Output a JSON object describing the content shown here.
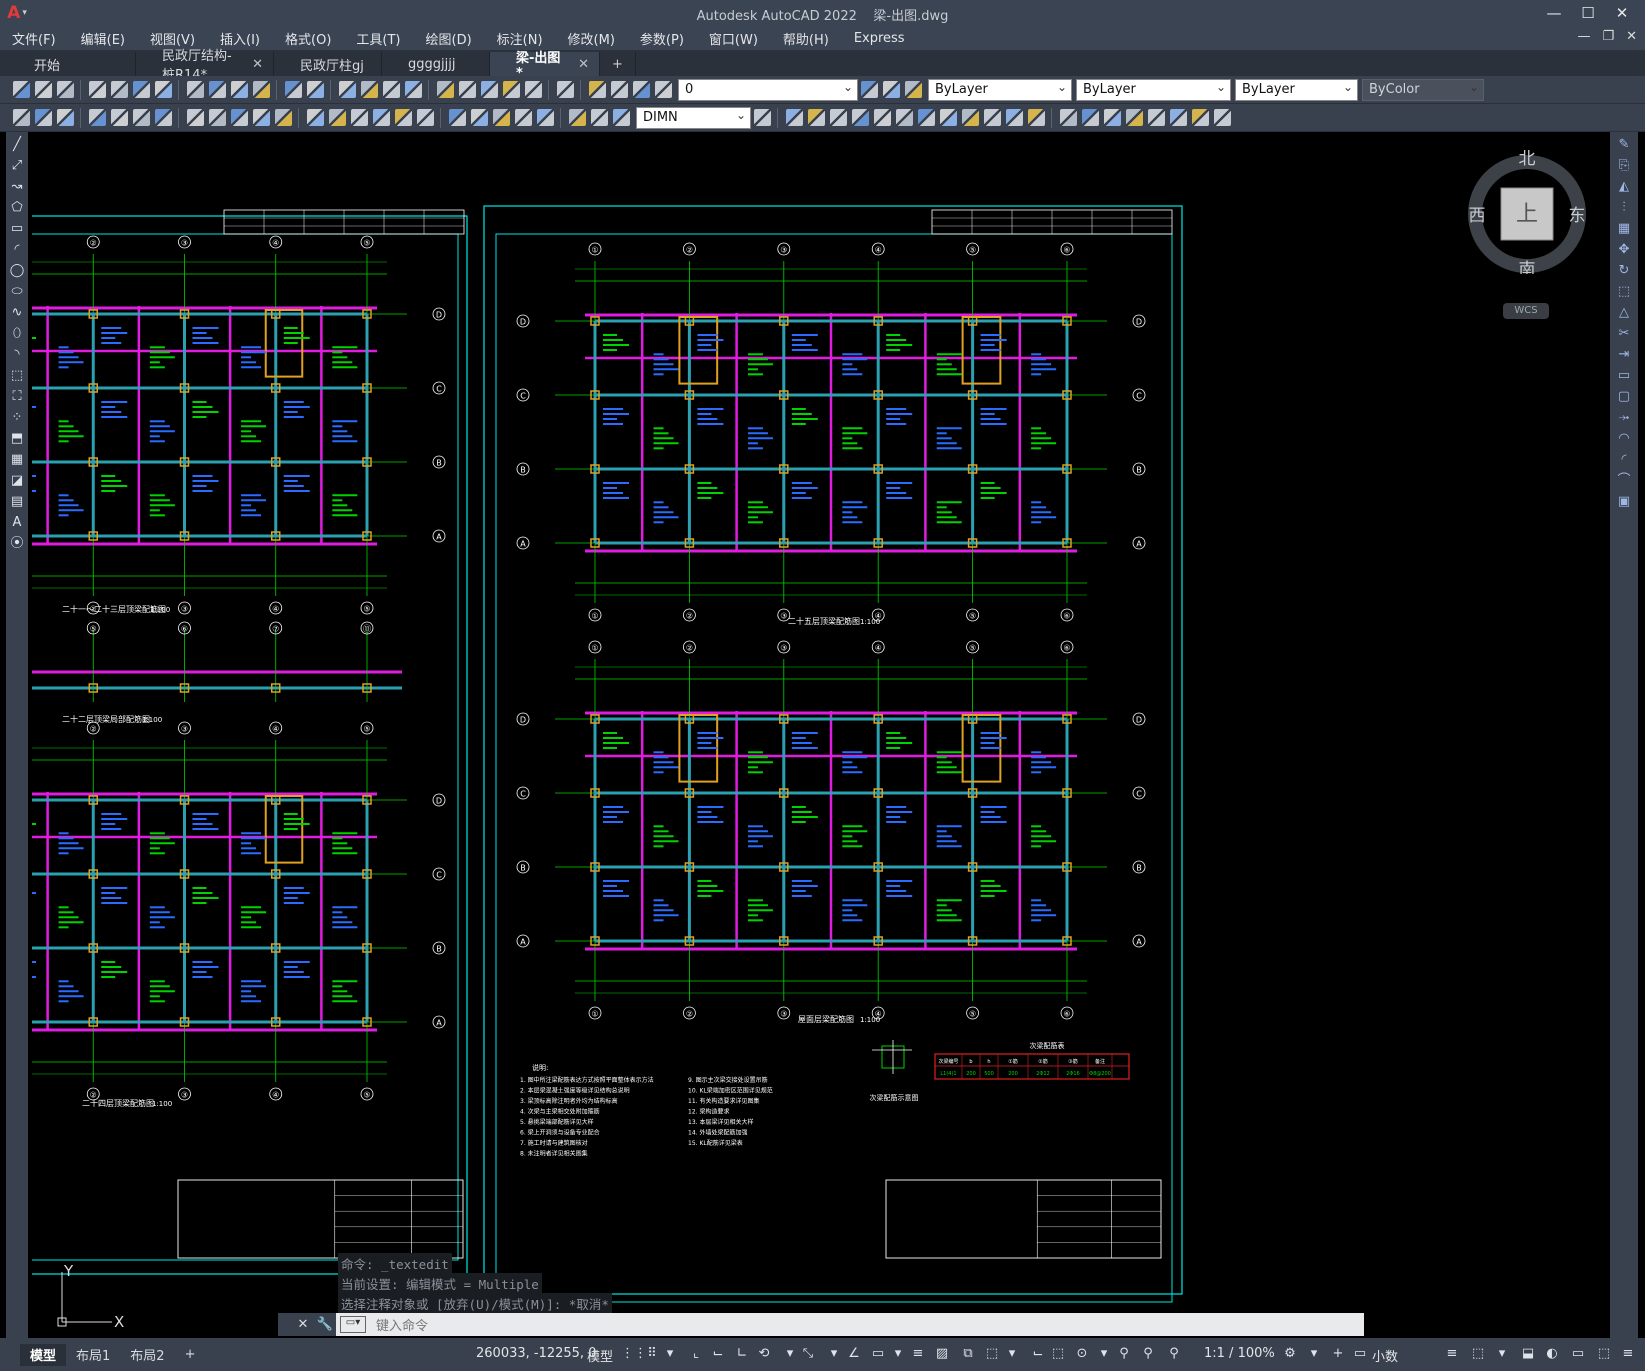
{
  "window": {
    "app_title": "Autodesk AutoCAD 2022",
    "file_title": "梁-出图.dwg",
    "logo_text": "A"
  },
  "menu": [
    "文件(F)",
    "编辑(E)",
    "视图(V)",
    "插入(I)",
    "格式(O)",
    "工具(T)",
    "绘图(D)",
    "标注(N)",
    "修改(M)",
    "参数(P)",
    "窗口(W)",
    "帮助(H)",
    "Express"
  ],
  "tabs": [
    {
      "label": "开始",
      "closable": false,
      "active": false
    },
    {
      "label": "民政厅结构-桩R14*",
      "closable": true,
      "active": false
    },
    {
      "label": "民政厅柱gj",
      "closable": false,
      "active": false
    },
    {
      "label": "ggggjjjj",
      "closable": false,
      "active": false
    },
    {
      "label": "梁-出图*",
      "closable": true,
      "active": true
    }
  ],
  "tab_plus": "+",
  "toolbar": {
    "layer_value": "0",
    "color_value": "ByLayer",
    "linetype_value": "ByLayer",
    "lineweight_value": "ByLayer",
    "plotstyle_value": "ByColor",
    "dimstyle_value": "DIMN"
  },
  "viewcube": {
    "north": "北",
    "south": "南",
    "east": "东",
    "west": "西",
    "face": "上",
    "wcs": "WCS"
  },
  "drawing": {
    "left_plan_titles": [
      "二十一～二十三层顶梁配筋图",
      "二十二层顶梁局部配筋图",
      "二十四层顶梁配筋图"
    ],
    "right_plan_titles": [
      "二十五层顶梁配筋图",
      "屋面层梁配筋图"
    ],
    "scale_note": "1:100",
    "notes_heading": "说明:",
    "notes": [
      "1. 图中所注梁配筋表达方式按照平面整体表示方法",
      "2. 本层梁混凝土强度等级详见结构总说明",
      "3. 梁顶标高除注明者外均为结构标高",
      "4. 次梁与主梁相交处附加箍筋",
      "5. 悬挑梁端部配筋详见大样",
      "6. 梁上开洞须与设备专业配合",
      "7. 施工时请与建筑图核对",
      "8. 未注明者详见相关图集"
    ],
    "notes_right": [
      "9. 图示主次梁交接处设置吊筋",
      "10. KL梁端加密区范围详见规范",
      "11. 有关构造要求详见图集",
      "12. 梁构造要求",
      "13. 本层梁详见相关大样",
      "14. 外墙处梁配筋加强",
      "15. KL配筋详见梁表"
    ],
    "beam_table_title": "次梁配筋表",
    "beam_table_headers": [
      "次梁编号",
      "b",
      "h",
      "①筋",
      "②筋",
      "③筋",
      "备注"
    ],
    "beam_table_row": [
      "L1(4)1",
      "200",
      "500",
      "200",
      "2Φ12",
      "2Φ16",
      "Φ8@200"
    ],
    "detail_caption": "次梁配筋示意图",
    "axis_numbers": [
      "①",
      "②",
      "③",
      "④",
      "⑤",
      "⑥",
      "⑦",
      "⑪"
    ],
    "axis_letters": [
      "A",
      "B",
      "C",
      "D"
    ]
  },
  "ucs": {
    "x": "X",
    "y": "Y"
  },
  "command": {
    "history": [
      "命令: _textedit",
      "当前设置: 编辑模式 = Multiple",
      "选择注释对象或 [放弃(U)/模式(M)]: *取消*"
    ],
    "placeholder": "键入命令"
  },
  "status": {
    "layout_tabs": [
      "模型",
      "布局1",
      "布局2"
    ],
    "add_tab": "+",
    "coordinates": "260033, -12255, 0",
    "space": "模型",
    "scale": "1:1 / 100%",
    "units": "小数"
  },
  "colors": {
    "frame_cyan": "#00e5e5",
    "beam_magenta": "#e01ce0",
    "grid_green": "#00d400",
    "column_orange": "#e0a020",
    "text_blue": "#2a6cff",
    "dim_red": "#e02020",
    "white": "#ffffff"
  }
}
